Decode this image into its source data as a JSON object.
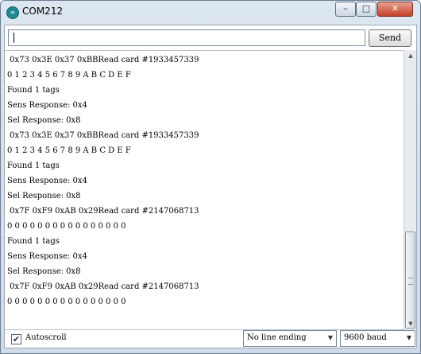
{
  "window": {
    "title": "COM212",
    "icon": "arduino-infinity-icon",
    "controls": {
      "minimize": "–",
      "maximize": "□",
      "close": "✕"
    }
  },
  "input": {
    "value": "",
    "placeholder": ""
  },
  "send_label": "Send",
  "output_lines": [
    " 0x73 0x3E 0x37 0xBBRead card #1933457339",
    "0 1 2 3 4 5 6 7 8 9 A B C D E F",
    "Found 1 tags",
    "Sens Response: 0x4",
    "Sel Response: 0x8",
    " 0x73 0x3E 0x37 0xBBRead card #1933457339",
    "0 1 2 3 4 5 6 7 8 9 A B C D E F",
    "Found 1 tags",
    "Sens Response: 0x4",
    "Sel Response: 0x8",
    " 0x7F 0xF9 0xAB 0x29Read card #2147068713",
    "0 0 0 0 0 0 0 0 0 0 0 0 0 0 0 0",
    "Found 1 tags",
    "Sens Response: 0x4",
    "Sel Response: 0x8",
    " 0x7F 0xF9 0xAB 0x29Read card #2147068713",
    "0 0 0 0 0 0 0 0 0 0 0 0 0 0 0 0"
  ],
  "scroll": {
    "position_fraction": 1.0
  },
  "autoscroll": {
    "label": "Autoscroll",
    "checked": true
  },
  "line_ending": {
    "selected": "No line ending"
  },
  "baud_rate": {
    "selected": "9600 baud"
  },
  "colors": {
    "close_button": "#c4412a",
    "icon": "#1f8a93"
  }
}
